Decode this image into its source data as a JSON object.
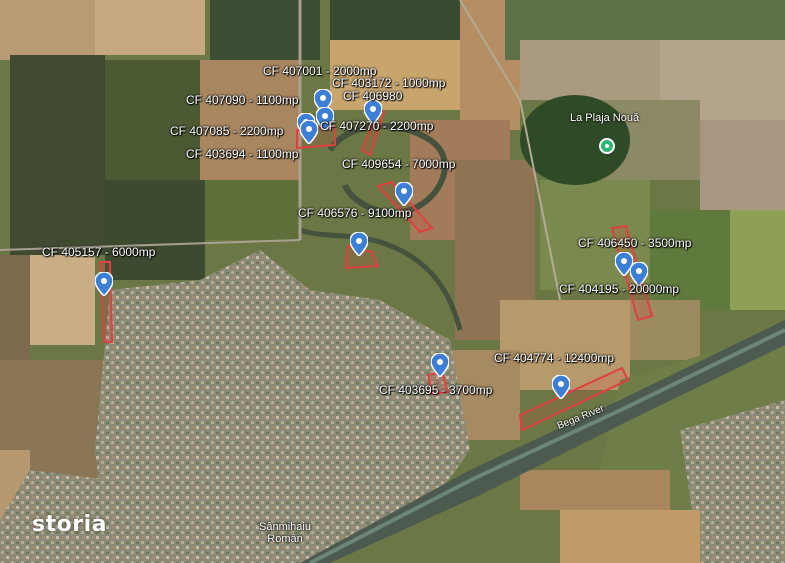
{
  "map": {
    "brand": "storia",
    "place_name": "Sânmihaiu Român",
    "poi": "La Plaja Nouă",
    "river": "Bega River",
    "plot_color": "#e04040",
    "pin_color": "#3d7fd6",
    "poi_color": "#2cb673",
    "plots": [
      {
        "id": "p1",
        "label": "CF 407001 - 2000mp"
      },
      {
        "id": "p2",
        "label": "CF 403172 - 1000mp"
      },
      {
        "id": "p3",
        "label": "CF 406980"
      },
      {
        "id": "p4",
        "label": "CF 407090 - 1100mp"
      },
      {
        "id": "p5",
        "label": "CF 407085 - 2200mp"
      },
      {
        "id": "p6",
        "label": "CF 407270 - 2200mp"
      },
      {
        "id": "p7",
        "label": "CF 403694 - 1100mp"
      },
      {
        "id": "p8",
        "label": "CF 409654 - 7000mp"
      },
      {
        "id": "p9",
        "label": "CF 406576 - 9100mp"
      },
      {
        "id": "p10",
        "label": "CF 406450 - 3500mp"
      },
      {
        "id": "p11",
        "label": "CF 405157 - 6000mp"
      },
      {
        "id": "p12",
        "label": "CF 404195 - 20000mp"
      },
      {
        "id": "p13",
        "label": "CF 404774 - 12400mp"
      },
      {
        "id": "p14",
        "label": "CF 403695 - 3700mp"
      }
    ]
  }
}
